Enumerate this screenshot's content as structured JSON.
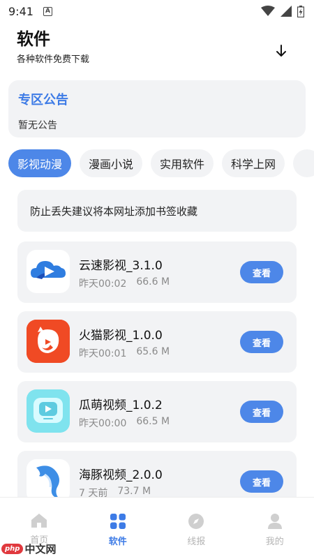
{
  "status_bar": {
    "time": "9:41",
    "notif_icon": "a-icon"
  },
  "header": {
    "title": "软件",
    "subtitle": "各种软件免费下载",
    "download_icon": "download-icon"
  },
  "notice": {
    "title": "专区公告",
    "text": "暂无公告"
  },
  "tabs": [
    {
      "label": "影视动漫",
      "active": true
    },
    {
      "label": "漫画小说",
      "active": false
    },
    {
      "label": "实用软件",
      "active": false
    },
    {
      "label": "科学上网",
      "active": false
    },
    {
      "label": "",
      "active": false
    }
  ],
  "tip": "防止丢失建议将本网址添加书签收藏",
  "apps": [
    {
      "name": "云速影视_3.1.0",
      "time": "昨天00:02",
      "size": "66.6 M",
      "button": "查看",
      "icon": "cloud-play-icon"
    },
    {
      "name": "火猫影视_1.0.0",
      "time": "昨天00:01",
      "size": "65.6 M",
      "button": "查看",
      "icon": "fire-cat-icon"
    },
    {
      "name": "瓜萌视频_1.0.2",
      "time": "昨天00:00",
      "size": "66.5 M",
      "button": "查看",
      "icon": "tv-play-icon"
    },
    {
      "name": "海豚视频_2.0.0",
      "time": "7 天前",
      "size": "73.7 M",
      "button": "查看",
      "icon": "dolphin-icon"
    }
  ],
  "bottom_nav": [
    {
      "label": "首页",
      "icon": "home-icon",
      "active": false
    },
    {
      "label": "软件",
      "icon": "grid-icon",
      "active": true
    },
    {
      "label": "线报",
      "icon": "compass-icon",
      "active": false
    },
    {
      "label": "我的",
      "icon": "user-icon",
      "active": false
    }
  ],
  "watermark": {
    "badge": "php",
    "text": "中文网"
  },
  "colors": {
    "accent": "#4d87e8",
    "card_bg": "#f2f3f5",
    "meta_text": "#8a8a8a"
  }
}
